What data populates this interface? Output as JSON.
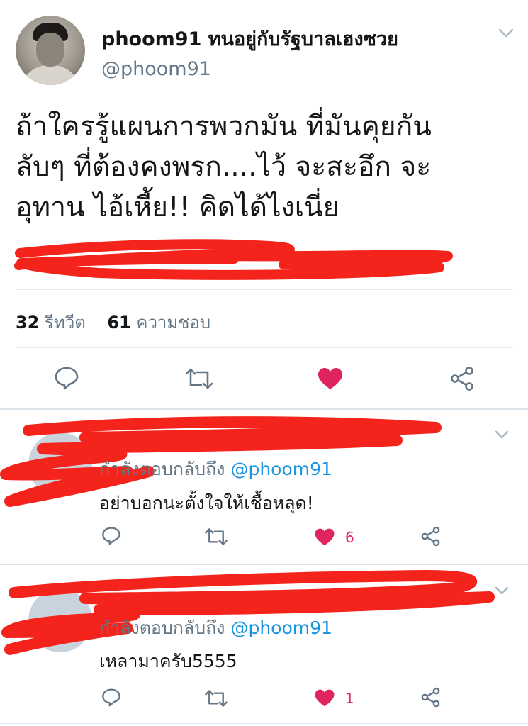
{
  "tweet": {
    "display_name": "phoom91 ทนอยู่กับรัฐบาลเฮงซวย",
    "handle": "@phoom91",
    "text_lines": [
      "ถ้าใครรู้แผนการพวกมัน ที่มันคุยกัน",
      "ลับๆ ที่ต้องคงพรก....ไว้  จะสะอึก จะ",
      "อุทาน ไอ้เหี้ย!!  คิดได้ไงเนี่ย"
    ],
    "retweet_count": "32",
    "retweet_label": "รีทวีต",
    "like_count": "61",
    "like_label": "ความชอบ"
  },
  "replies": [
    {
      "replying_label": "กำลังตอบกลับถึง",
      "replying_handle": "@phoom91",
      "text": "อย่าบอกนะตั้งใจให้เชื้อหลุด!",
      "like_count": "6"
    },
    {
      "replying_label": "กำลังตอบกลับถึง",
      "replying_handle": "@phoom91",
      "text": "เหลามาครับ5555",
      "like_count": "1"
    }
  ],
  "icons": [
    "reply-icon",
    "retweet-icon",
    "heart-icon",
    "share-icon",
    "chevron-down-icon"
  ],
  "colors": {
    "like": "#e0245e",
    "link": "#1b95e0",
    "muted": "#657786",
    "redaction": "#f4231b"
  }
}
